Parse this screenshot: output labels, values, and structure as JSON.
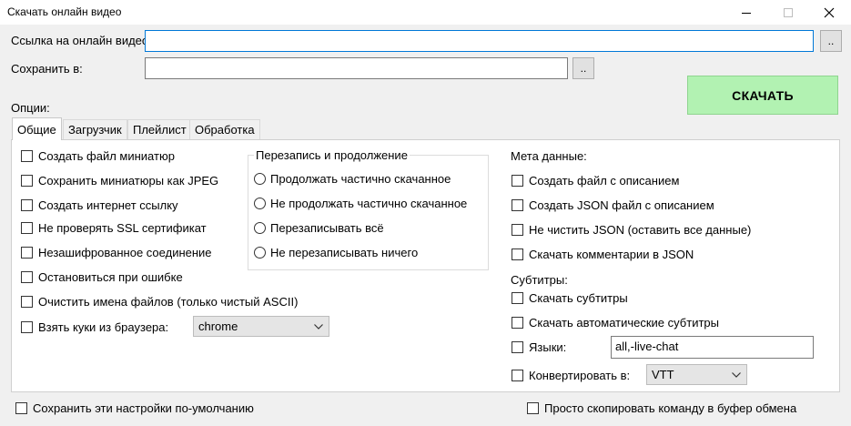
{
  "window": {
    "title": "Скачать онлайн видео"
  },
  "form": {
    "url_label": "Ссылка на онлайн видео",
    "url_value": "",
    "browse_label": "..",
    "save_label": "Сохранить в:",
    "save_value": "",
    "save_browse_label": "..",
    "download_label": "СКАЧАТЬ",
    "options_label": "Опции:"
  },
  "tabs": [
    {
      "label": "Общие",
      "active": true
    },
    {
      "label": "Загрузчик",
      "active": false
    },
    {
      "label": "Плейлист",
      "active": false
    },
    {
      "label": "Обработка",
      "active": false
    }
  ],
  "general": {
    "checkboxes": [
      {
        "label": "Создать файл миниатюр",
        "checked": false
      },
      {
        "label": "Сохранить миниатюры как JPEG",
        "checked": false
      },
      {
        "label": "Создать интернет ссылку",
        "checked": false
      },
      {
        "label": "Не проверять SSL сертификат",
        "checked": false
      },
      {
        "label": "Незашифрованное соединение",
        "checked": false
      },
      {
        "label": "Остановиться при ошибке",
        "checked": false
      },
      {
        "label": "Очистить имена файлов (только чистый ASCII)",
        "checked": false
      }
    ],
    "cookies": {
      "label": "Взять куки из браузера:",
      "checked": false,
      "selected": "chrome"
    }
  },
  "overwrite": {
    "title": "Перезапись и продолжение",
    "options": [
      {
        "label": "Продолжать частично скачанное",
        "selected": false
      },
      {
        "label": "Не продолжать частично скачанное",
        "selected": false
      },
      {
        "label": "Перезаписывать всё",
        "selected": false
      },
      {
        "label": "Не перезаписывать ничего",
        "selected": false
      }
    ]
  },
  "meta": {
    "title": "Мета данные:",
    "checkboxes": [
      {
        "label": "Создать файл с описанием",
        "checked": false
      },
      {
        "label": "Создать JSON файл с описанием",
        "checked": false
      },
      {
        "label": "Не чистить JSON (оставить все данные)",
        "checked": false
      },
      {
        "label": "Скачать комментарии в JSON",
        "checked": false
      }
    ]
  },
  "subtitles": {
    "title": "Субтитры:",
    "download": {
      "label": "Скачать субтитры",
      "checked": false
    },
    "auto": {
      "label": "Скачать автоматические субтитры",
      "checked": false
    },
    "languages": {
      "label": "Языки:",
      "checked": false,
      "value": "all,-live-chat"
    },
    "convert": {
      "label": "Конвертировать в:",
      "checked": false,
      "selected": "VTT"
    }
  },
  "footer": {
    "save_defaults": {
      "label": "Сохранить эти настройки по-умолчанию",
      "checked": false
    },
    "copy_command": {
      "label": "Просто скопировать команду в буфер обмена",
      "checked": false
    }
  },
  "colors": {
    "download_bg": "#b2f2b2",
    "focus_border": "#0078d7",
    "window_bg": "#f0f0f0"
  },
  "icons": {
    "minimize": "minimize-icon",
    "maximize": "maximize-icon",
    "close": "close-icon",
    "dropdown": "chevron-down-icon"
  }
}
